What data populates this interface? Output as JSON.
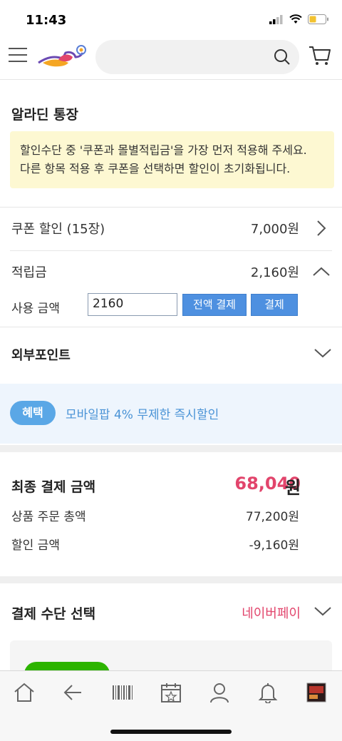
{
  "status_bar": {
    "time": "11:43"
  },
  "header": {
    "search": {
      "placeholder": ""
    }
  },
  "account": {
    "title": "알라딘 통장",
    "notice": [
      "할인수단 중 '쿠폰과 몰별적립금'을 가장 먼저 적용해 주세요.",
      "다른 항목 적용 후 쿠폰을 선택하면 할인이 초기화됩니다."
    ],
    "coupon": {
      "label": "쿠폰 할인 (15장)",
      "value": "7,000원"
    },
    "points": {
      "label": "적립금",
      "value": "2,160원"
    },
    "use_amount": {
      "label": "사용 금액",
      "value": "2160",
      "pay_all_label": "전액 결제",
      "pay_label": "결제"
    },
    "external_points": {
      "label": "외부포인트"
    }
  },
  "benefit": {
    "badge": "혜택",
    "text": "모바일팝 4% 무제한 즉시할인"
  },
  "summary": {
    "title": "최종 결제 금액",
    "total": "68,040",
    "total_unit": "원",
    "rows": [
      {
        "label": "상품 주문 총액",
        "value": "77,200원"
      },
      {
        "label": "할인 금액",
        "value": "-9,160원"
      }
    ]
  },
  "payment": {
    "title": "결제 수단 선택",
    "selected": "네이버페이"
  },
  "colors": {
    "accent_pink": "#e2456c",
    "accent_blue": "#4e90e0",
    "notice_bg": "#fdf8d2",
    "naver_green": "#2db400"
  },
  "tabbar": {
    "icons": [
      "home-icon",
      "back-icon",
      "barcode-icon",
      "calendar-icon",
      "user-icon",
      "bell-icon",
      "recent-item-thumbnail"
    ]
  }
}
